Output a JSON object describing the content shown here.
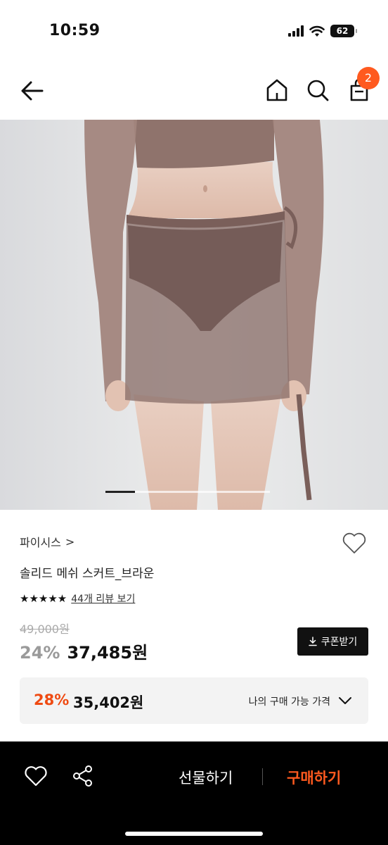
{
  "status_bar": {
    "time": "10:59",
    "battery": "62"
  },
  "nav": {
    "cart_badge": "2"
  },
  "carousel": {
    "current_index": 1,
    "total_fraction_active": 0.18
  },
  "product": {
    "brand": "파이시스",
    "brand_chevron": ">",
    "title": "솔리드 메쉬 스커트_브라운",
    "rating_stars": 5,
    "review_link": "44개 리뷰 보기",
    "original_price": "49,000원",
    "discount": "24%",
    "sale_price": "37,485원",
    "coupon_label": "쿠폰받기"
  },
  "my_price": {
    "discount": "28%",
    "price": "35,402원",
    "label": "나의 구매 가능 가격"
  },
  "bottom_bar": {
    "gift_label": "선물하기",
    "buy_label": "구매하기"
  },
  "colors": {
    "accent": "#ff5a1f",
    "my_price_discount": "#ef4a12",
    "bottom_bar_bg": "#000000",
    "skirt": "#8a6f6a"
  },
  "icons": [
    "back-arrow-icon",
    "home-icon",
    "search-icon",
    "cart-icon",
    "heart-icon",
    "download-icon",
    "chevron-down-icon",
    "share-icon"
  ]
}
